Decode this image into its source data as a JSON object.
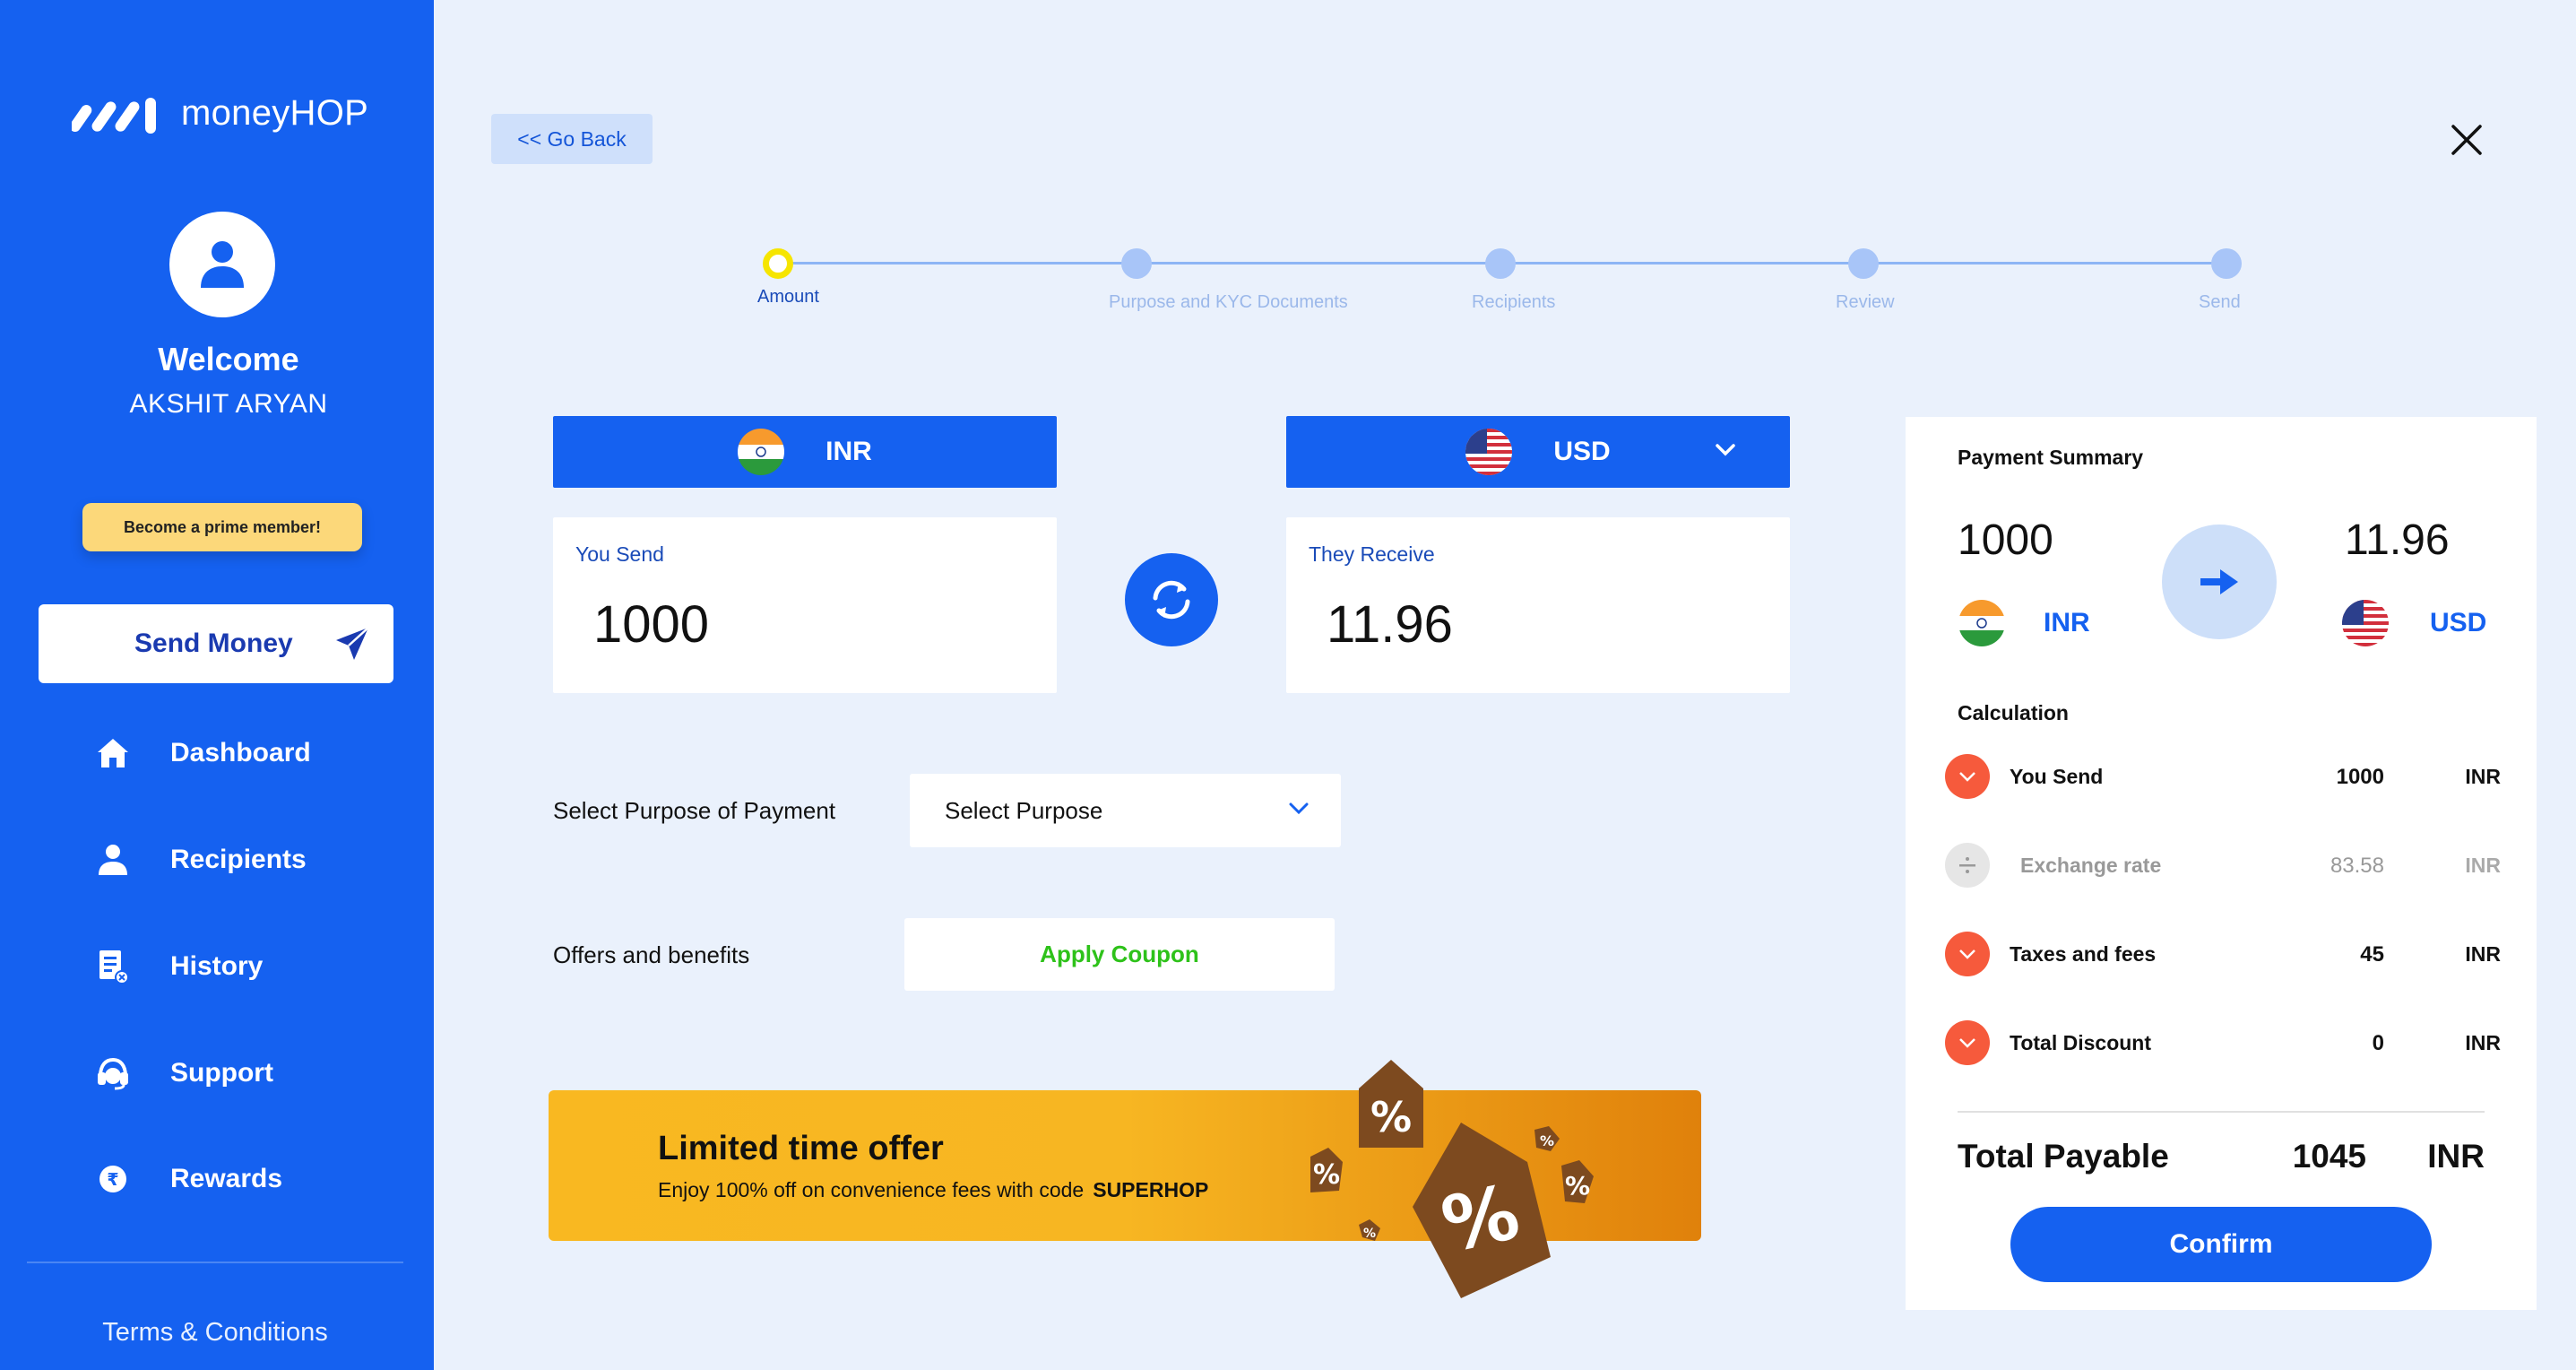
{
  "brand": {
    "name": "moneyHOP"
  },
  "user": {
    "welcome": "Welcome",
    "name": "AKSHIT ARYAN"
  },
  "sidebar": {
    "prime_label": "Become a prime member!",
    "send_money_label": "Send Money",
    "items": [
      {
        "label": "Dashboard",
        "icon": "home-icon"
      },
      {
        "label": "Recipients",
        "icon": "person-icon"
      },
      {
        "label": "History",
        "icon": "history-icon"
      },
      {
        "label": "Support",
        "icon": "headset-icon"
      },
      {
        "label": "Rewards",
        "icon": "rupee-coin-icon"
      }
    ],
    "terms": "Terms & Conditions"
  },
  "header": {
    "go_back": "<< Go Back"
  },
  "stepper": {
    "steps": [
      "Amount",
      "Purpose and KYC Documents",
      "Recipients",
      "Review",
      "Send"
    ],
    "active_index": 0
  },
  "send": {
    "currency": "INR",
    "label": "You Send",
    "amount": "1000"
  },
  "receive": {
    "currency": "USD",
    "label": "They Receive",
    "amount": "11.96"
  },
  "purpose": {
    "label": "Select Purpose of Payment",
    "value": "Select Purpose"
  },
  "offers": {
    "label": "Offers and benefits",
    "coupon_button": "Apply Coupon"
  },
  "banner": {
    "title": "Limited time offer",
    "text": "Enjoy 100% off on convenience fees with code",
    "code": "SUPERHOP"
  },
  "summary": {
    "title": "Payment Summary",
    "send_amount": "1000",
    "send_currency": "INR",
    "receive_amount": "11.96",
    "receive_currency": "USD",
    "calc_title": "Calculation",
    "rows": [
      {
        "name": "You Send",
        "value": "1000",
        "unit": "INR"
      },
      {
        "name": "Exchange rate",
        "value": "83.58",
        "unit": "INR"
      },
      {
        "name": "Taxes and fees",
        "value": "45",
        "unit": "INR"
      },
      {
        "name": "Total Discount",
        "value": "0",
        "unit": "INR"
      }
    ],
    "total_label": "Total Payable",
    "total_value": "1045",
    "total_unit": "INR",
    "confirm": "Confirm"
  },
  "colors": {
    "primary": "#1561f0",
    "background": "#eaf1fc",
    "accent_red": "#f65a3c",
    "coupon_green": "#2ec21a",
    "banner_yellow": "#f9b821"
  }
}
